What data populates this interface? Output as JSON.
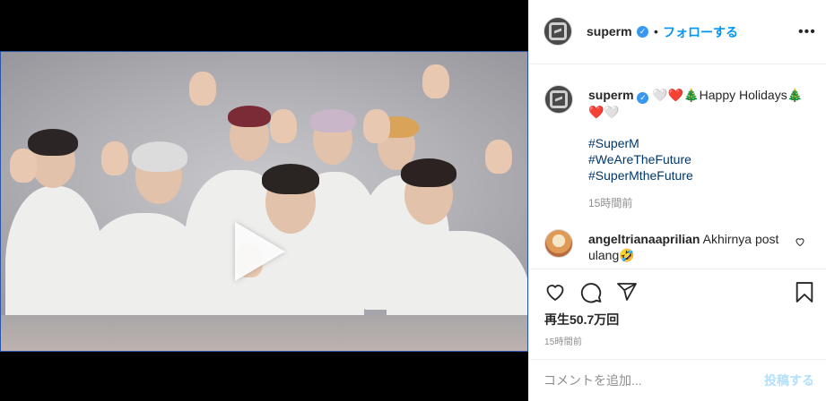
{
  "header": {
    "username": "superm",
    "separator": "•",
    "follow_label": "フォローする",
    "more_label": "•••"
  },
  "caption": {
    "username": "superm",
    "emojis_prefix": "🤍❤️🎄",
    "text": "Happy Holidays",
    "emojis_suffix": "🎄❤️🤍",
    "hashtags": [
      "#SuperM",
      "#WeAreTheFuture",
      "#SuperMtheFuture"
    ],
    "time": "15時間前"
  },
  "comment": {
    "username": "angeltrianaaprilian",
    "text": "Akhirnya post ulang🤣"
  },
  "stats": {
    "views": "再生50.7万回",
    "time": "15時間前"
  },
  "add_comment": {
    "placeholder": "コメントを追加...",
    "post_label": "投稿する"
  },
  "icons": {
    "play": "play-icon",
    "mute": "muted-speaker-icon",
    "like": "heart-icon",
    "comment": "speech-bubble-icon",
    "share": "paper-plane-icon",
    "save": "bookmark-icon"
  },
  "colors": {
    "link_blue": "#0095f6",
    "hashtag": "#00376b",
    "post_disabled": "#b2dffc",
    "muted_text": "#8e8e8e",
    "verified": "#3897f0"
  }
}
